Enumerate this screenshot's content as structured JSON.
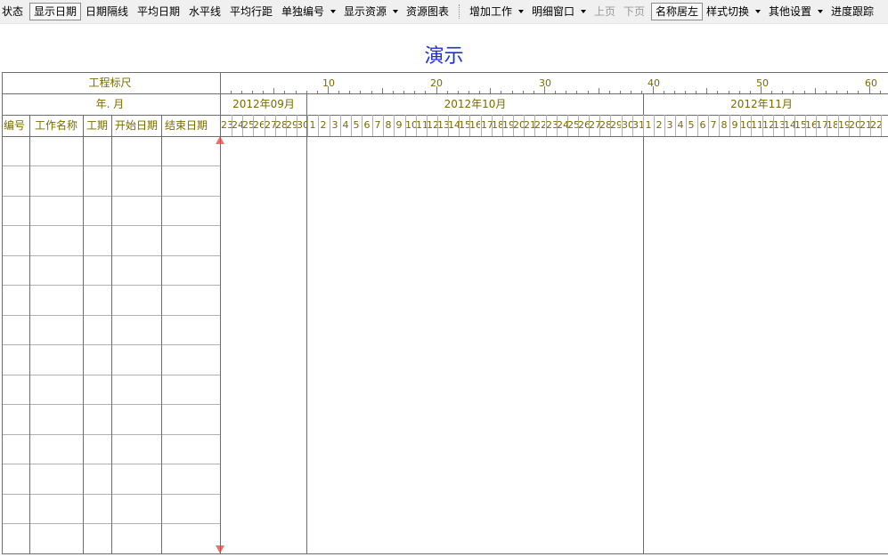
{
  "toolbar": {
    "status": "状态",
    "show_date": "显示日期",
    "date_separator": "日期隔线",
    "average_date": "平均日期",
    "horizontal_line": "水平线",
    "average_row_spacing": "平均行距",
    "single_numbering": "单独编号",
    "show_resources": "显示资源",
    "resource_chart": "资源图表",
    "add_work": "增加工作",
    "detail_window": "明细窗口",
    "prev_page": "上页",
    "next_page": "下页",
    "name_left": "名称居左",
    "style_switch": "样式切换",
    "other_settings": "其他设置",
    "progress_tracking": "进度跟踪"
  },
  "title": "演示",
  "header": {
    "ruler_label": "工程标尺",
    "year_month_label": "年. 月",
    "columns": {
      "id": "编号",
      "name": "工作名称",
      "duration": "工期",
      "start": "开始日期",
      "end": "结束日期"
    }
  },
  "timeline": {
    "ruler_numbers": [
      "10",
      "20",
      "30",
      "40",
      "50",
      "60"
    ],
    "months": [
      "2012年09月",
      "2012年10月",
      "2012年11月"
    ],
    "days": [
      "23",
      "24",
      "25",
      "26",
      "27",
      "28",
      "29",
      "30",
      "1",
      "2",
      "3",
      "4",
      "5",
      "6",
      "7",
      "8",
      "9",
      "10",
      "11",
      "12",
      "13",
      "14",
      "15",
      "16",
      "17",
      "18",
      "19",
      "20",
      "21",
      "22",
      "23",
      "24",
      "25",
      "26",
      "27",
      "28",
      "29",
      "30",
      "31",
      "1",
      "2",
      "3",
      "4",
      "5",
      "6",
      "7",
      "8",
      "9",
      "10",
      "11",
      "12",
      "13",
      "14",
      "15",
      "16",
      "17",
      "18",
      "19",
      "20",
      "21",
      "22"
    ]
  },
  "colors": {
    "title": "#1f2fd8",
    "header_text": "#7a6a00",
    "today_line": "#f07070"
  }
}
